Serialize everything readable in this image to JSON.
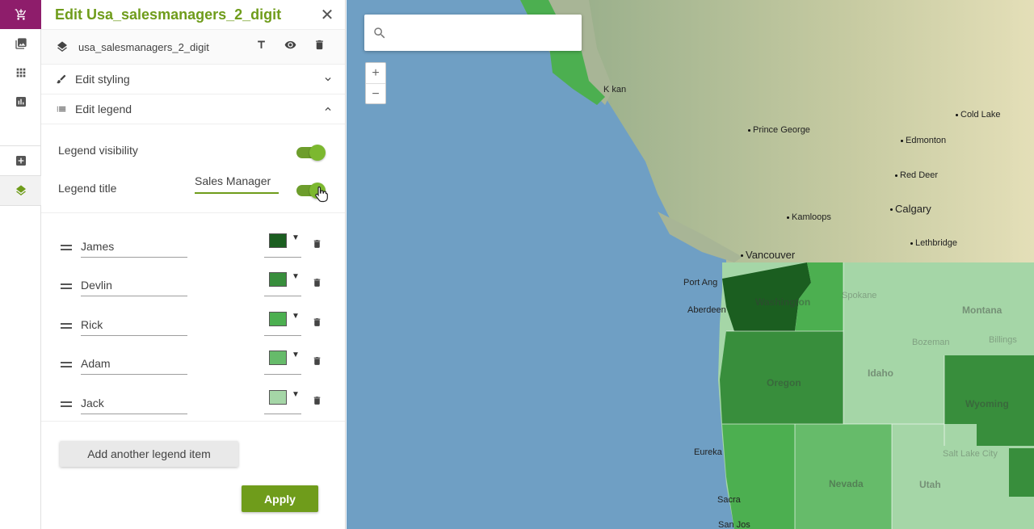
{
  "panel": {
    "title": "Edit Usa_salesmanagers_2_digit",
    "layer_name": "usa_salesmanagers_2_digit",
    "sections": {
      "styling": "Edit styling",
      "legend": "Edit legend"
    },
    "legend_visibility_label": "Legend visibility",
    "legend_title_label": "Legend title",
    "legend_title_value": "Sales Manager",
    "legend_visibility_on": true,
    "legend_title_on": true,
    "items": [
      {
        "label": "James",
        "color": "#1b5e20"
      },
      {
        "label": "Devlin",
        "color": "#388e3c"
      },
      {
        "label": "Rick",
        "color": "#4caf50"
      },
      {
        "label": "Adam",
        "color": "#66bb6a"
      },
      {
        "label": "Jack",
        "color": "#a5d6a7"
      }
    ],
    "add_item_label": "Add another legend item",
    "apply_label": "Apply"
  },
  "map": {
    "search_placeholder": "",
    "zoom_in": "+",
    "zoom_out": "−",
    "cities": {
      "cold_lake": "Cold Lake",
      "edmonton": "Edmonton",
      "prince_george": "Prince George",
      "red_deer": "Red Deer",
      "calgary": "Calgary",
      "kamloops": "Kamloops",
      "lethbridge": "Lethbridge",
      "vancouver": "Vancouver",
      "port_angeles": "Port Ang",
      "aberdeen": "Aberdeen",
      "eureka": "Eureka",
      "sacra": "Sacra",
      "san_jose": "San Jos",
      "ketchikan": "K    kan",
      "spokane": "Spokane",
      "billings": "Billings",
      "bozeman": "Bozeman",
      "salt_lake": "Salt Lake City"
    },
    "states": {
      "washington": "Washington",
      "oregon": "Oregon",
      "idaho": "Idaho",
      "montana": "Montana",
      "wyoming": "Wyoming",
      "nevada": "Nevada",
      "utah": "Utah"
    }
  },
  "colors": {
    "accent": "#6f9c1b",
    "rail_active": "#8e1d6b"
  }
}
